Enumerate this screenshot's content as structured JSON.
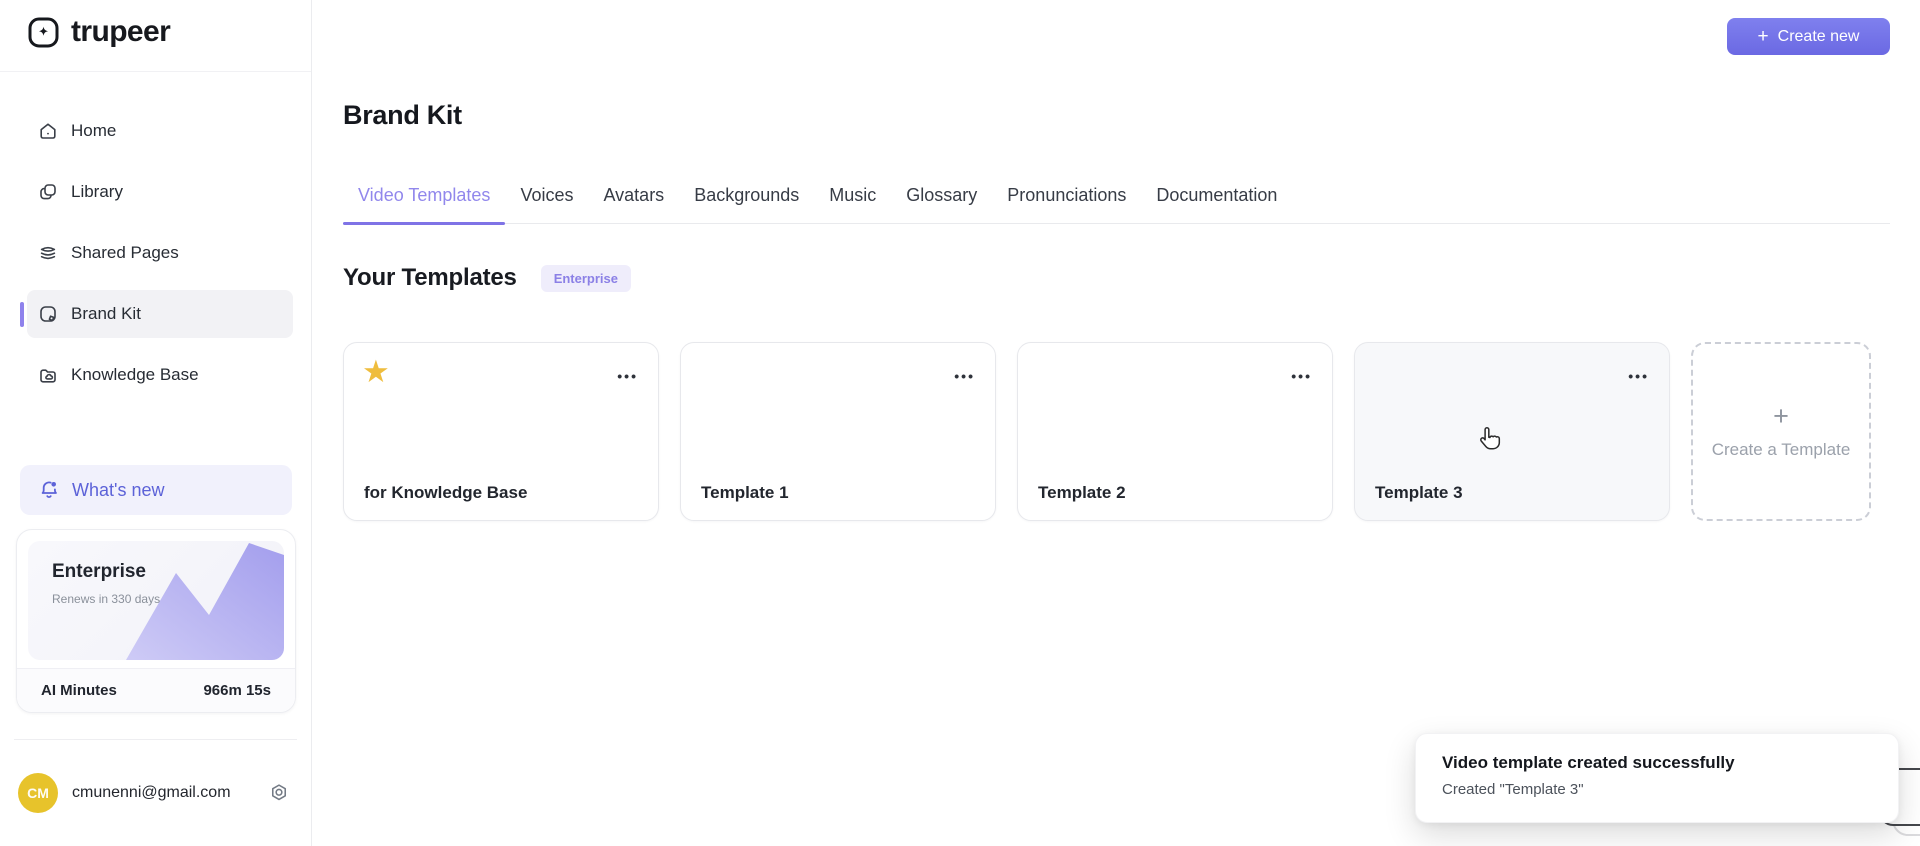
{
  "brand": {
    "name": "trupeer"
  },
  "sidebar": {
    "items": [
      {
        "label": "Home",
        "active": false
      },
      {
        "label": "Library",
        "active": false
      },
      {
        "label": "Shared Pages",
        "active": false
      },
      {
        "label": "Brand Kit",
        "active": true
      },
      {
        "label": "Knowledge Base",
        "active": false
      }
    ],
    "whats_new_label": "What's new",
    "plan_card": {
      "plan_name": "Enterprise",
      "renewal_note": "Renews in 330 days",
      "usage_label": "AI Minutes",
      "usage_value": "966m 15s"
    },
    "account": {
      "initials": "CM",
      "email": "cmunenni@gmail.com"
    }
  },
  "header": {
    "create_new_label": "Create new",
    "create_new_plus": "+"
  },
  "page": {
    "title": "Brand Kit",
    "tabs": [
      {
        "label": "Video Templates",
        "active": true
      },
      {
        "label": "Voices",
        "active": false
      },
      {
        "label": "Avatars",
        "active": false
      },
      {
        "label": "Backgrounds",
        "active": false
      },
      {
        "label": "Music",
        "active": false
      },
      {
        "label": "Glossary",
        "active": false
      },
      {
        "label": "Pronunciations",
        "active": false
      },
      {
        "label": "Documentation",
        "active": false
      }
    ],
    "section": {
      "title": "Your Templates",
      "badge": "Enterprise"
    }
  },
  "templates": {
    "cards": [
      {
        "name": "for Knowledge Base",
        "starred": true,
        "hovered": false
      },
      {
        "name": "Template 1",
        "starred": false,
        "hovered": false
      },
      {
        "name": "Template 2",
        "starred": false,
        "hovered": false
      },
      {
        "name": "Template 3",
        "starred": false,
        "hovered": true
      }
    ],
    "create_card_label": "Create a Template",
    "create_card_plus": "+"
  },
  "toast": {
    "title": "Video template created successfully",
    "message": "Created \"Template 3\""
  },
  "icons": {
    "star": "★",
    "menu_dots": "•••"
  },
  "colors": {
    "accent": "#6F6EE8",
    "accent_light": "#F1F1FC",
    "star": "#EFBD3E",
    "avatar": "#E7C32B"
  }
}
